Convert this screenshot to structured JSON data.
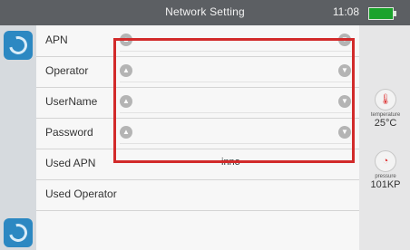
{
  "status_bar": {
    "title": "Network Setting",
    "time": "11:08",
    "battery_level": 1.0,
    "battery_color": "#1aa32b"
  },
  "left_nav": {
    "top_icon": "refresh-icon",
    "bottom_icon": "sync-icon"
  },
  "rows": [
    {
      "label": "APN",
      "type": "dropdown"
    },
    {
      "label": "Operator",
      "type": "dropdown"
    },
    {
      "label": "UserName",
      "type": "dropdown"
    },
    {
      "label": "Password",
      "type": "dropdown"
    },
    {
      "label": "Used APN",
      "value": "inno"
    },
    {
      "label": "Used Operator",
      "value": ""
    }
  ],
  "dropdown_icons": {
    "up": "chevron-up-icon",
    "down": "chevron-down-icon"
  },
  "right_panel": {
    "temperature": {
      "caption": "temperature",
      "value": "25°C",
      "icon": "thermometer-icon"
    },
    "pressure": {
      "caption": "pressure",
      "value": "101KP",
      "icon": "pressure-gauge-icon"
    }
  },
  "highlight_color": "#d22a2a"
}
